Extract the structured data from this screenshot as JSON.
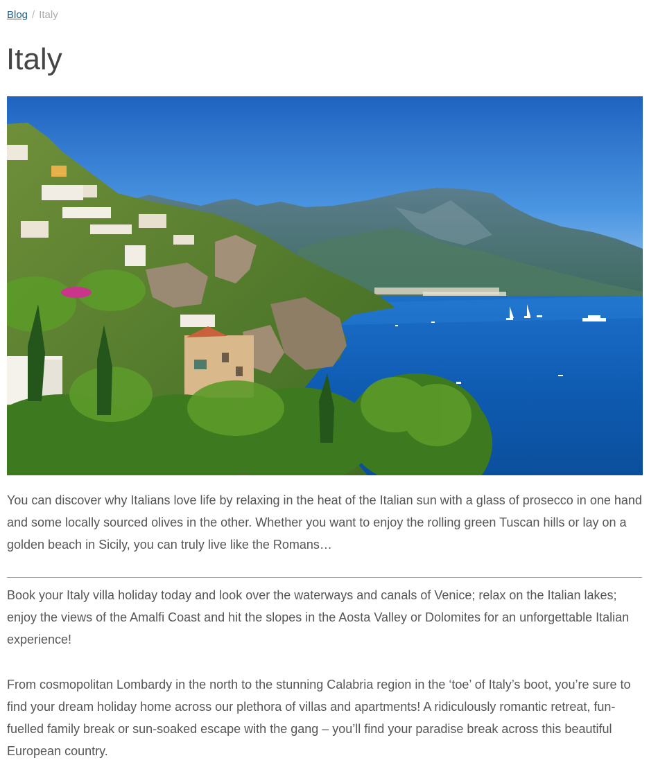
{
  "breadcrumb": {
    "items": [
      {
        "label": "Blog"
      },
      {
        "label": "Italy"
      }
    ],
    "separator": "/"
  },
  "page": {
    "title": "Italy"
  },
  "hero_image": {
    "subject": "Amalfi Coast cliffside village and blue sea"
  },
  "content": {
    "paragraphs": [
      "You can discover why Italians love life by relaxing in the heat of the Italian sun with a glass of prosecco in one hand and some locally sourced olives in the other. Whether you want to enjoy the rolling green Tuscan hills or lay on a golden beach in Sicily, you can truly live like the Romans…",
      "Book your Italy villa holiday today and look over the waterways and canals of Venice; relax on the Italian lakes; enjoy the views of the Amalfi Coast and hit the slopes in the Aosta Valley or Dolomites for an unforgettable Italian experience!",
      "From cosmopolitan Lombardy in the north to the stunning Calabria region in the ‘toe’ of Italy’s boot, you’re sure to find your dream holiday home across our plethora of villas and apartments! A ridiculously romantic retreat, fun-fuelled family break or sun-soaked escape with the gang – you’ll find your paradise break across this beautiful European country."
    ]
  },
  "colors": {
    "link": "#1f5f8b",
    "text": "#555555",
    "title": "#444444",
    "sky": "#2f7fd0",
    "sea": "#1f6fc4"
  }
}
